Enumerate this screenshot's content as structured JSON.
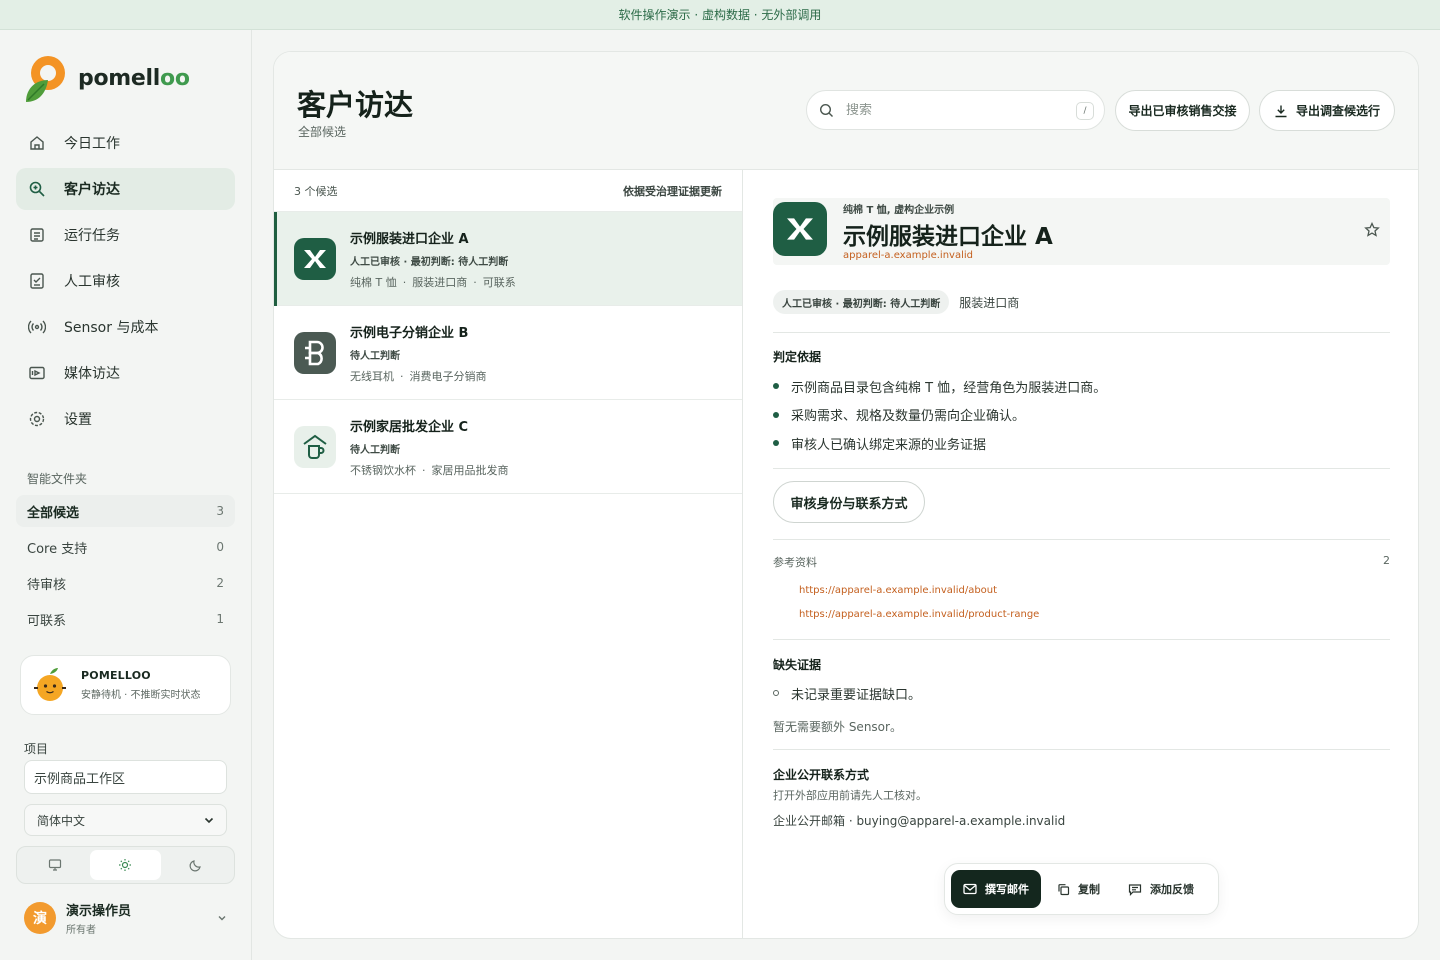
{
  "banner": "软件操作演示 · 虚构数据 · 无外部调用",
  "brand": {
    "name_main": "pomell",
    "name_suffix": "oo"
  },
  "nav": [
    {
      "label": "今日工作",
      "icon": "home-icon",
      "active": false
    },
    {
      "label": "客户访达",
      "icon": "search-icon",
      "active": true
    },
    {
      "label": "运行任务",
      "icon": "list-icon",
      "active": false
    },
    {
      "label": "人工审核",
      "icon": "checklist-icon",
      "active": false
    },
    {
      "label": "Sensor 与成本",
      "icon": "radar-icon",
      "active": false
    },
    {
      "label": "媒体访达",
      "icon": "media-icon",
      "active": false
    },
    {
      "label": "设置",
      "icon": "gear-icon",
      "active": false
    }
  ],
  "smart_folders": {
    "title": "智能文件夹",
    "items": [
      {
        "label": "全部候选",
        "count": "3",
        "active": true
      },
      {
        "label": "Core 支持",
        "count": "0",
        "active": false
      },
      {
        "label": "待审核",
        "count": "2",
        "active": false
      },
      {
        "label": "可联系",
        "count": "1",
        "active": false
      }
    ]
  },
  "assistant": {
    "name": "POMELLOO",
    "status": "安静待机 · 不推断实时状态"
  },
  "project": {
    "label": "项目",
    "value": "示例商品工作区",
    "language": "简体中文"
  },
  "user": {
    "name": "演示操作员",
    "role": "所有者",
    "initial": "演"
  },
  "header": {
    "title": "客户访达",
    "subtitle": "全部候选",
    "search_placeholder": "搜索",
    "search_shortcut": "/",
    "export_reviewed": "导出已审核销售交接",
    "export_survey": "导出调查候选行"
  },
  "list": {
    "count_label": "3 个候选",
    "sort_label": "依据受治理证据更新",
    "rows": [
      {
        "title": "示例服装进口企业 A",
        "status": "人工已审核 · 最初判断: 待人工判断",
        "tags": [
          "纯棉 T 恤",
          "服装进口商",
          "可联系"
        ],
        "logo": "excel-logo-icon",
        "active": true
      },
      {
        "title": "示例电子分销企业 B",
        "status": "待人工判断",
        "tags": [
          "无线耳机",
          "消费电子分销商"
        ],
        "logo": "b-logo-icon",
        "active": false
      },
      {
        "title": "示例家居批发企业 C",
        "status": "待人工判断",
        "tags": [
          "不锈钢饮水杯",
          "家居用品批发商"
        ],
        "logo": "house-cup-logo-icon",
        "active": false
      }
    ]
  },
  "detail": {
    "kicker": "纯棉 T 恤, 虚构企业示例",
    "title": "示例服装进口企业 A",
    "domain": "apparel-a.example.invalid",
    "badge": "人工已审核 · 最初判断: 待人工判断",
    "role": "服装进口商",
    "basis_title": "判定依据",
    "basis": [
      "示例商品目录包含纯棉 T 恤，经营角色为服装进口商。",
      "采购需求、规格及数量仍需向企业确认。",
      "审核人已确认绑定来源的业务证据"
    ],
    "review_button": "审核身份与联系方式",
    "refs_title": "参考资料",
    "refs_count": "2",
    "refs": [
      "https://apparel-a.example.invalid/about",
      "https://apparel-a.example.invalid/product-range"
    ],
    "missing_title": "缺失证据",
    "missing": [
      "未记录重要证据缺口。"
    ],
    "sensor_note": "暂无需要额外 Sensor。",
    "contact_title": "企业公开联系方式",
    "contact_note": "打开外部应用前请先人工核对。",
    "contact_email": "企业公开邮箱 · buying@apparel-a.example.invalid"
  },
  "actions": {
    "compose": "撰写邮件",
    "copy": "复制",
    "feedback": "添加反馈"
  },
  "colors": {
    "accent": "#1f5e44",
    "link": "#c4601f",
    "banner_bg": "#e3efe6"
  }
}
